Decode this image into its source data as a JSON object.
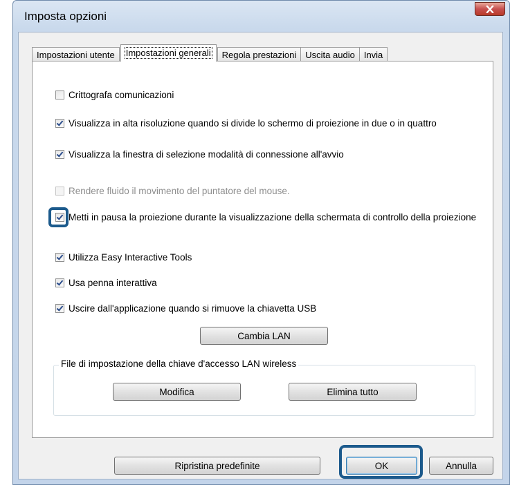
{
  "window": {
    "title": "Imposta opzioni"
  },
  "tabs": [
    {
      "label": "Impostazioni utente",
      "active": false
    },
    {
      "label": "Impostazioni generali",
      "active": true
    },
    {
      "label": "Regola prestazioni",
      "active": false
    },
    {
      "label": "Uscita audio",
      "active": false
    },
    {
      "label": "Invia",
      "active": false
    }
  ],
  "options": [
    {
      "label": "Crittografa comunicazioni",
      "checked": false,
      "enabled": true
    },
    {
      "label": "Visualizza in alta risoluzione quando si divide lo schermo di proiezione in due o in quattro",
      "checked": true,
      "enabled": true
    },
    {
      "label": "Visualizza la finestra di selezione modalità di connessione all'avvio",
      "checked": true,
      "enabled": true
    },
    {
      "label": "Rendere fluido il movimento del puntatore del mouse.",
      "checked": false,
      "enabled": false
    },
    {
      "label": "Metti in pausa la proiezione  durante la visualizzazione della schermata di controllo della proiezione",
      "checked": true,
      "enabled": true
    },
    {
      "label": "Utilizza Easy Interactive Tools",
      "checked": true,
      "enabled": true
    },
    {
      "label": "Usa penna interattiva",
      "checked": true,
      "enabled": true
    },
    {
      "label": "Uscire dall'applicazione quando si rimuove la chiavetta USB",
      "checked": true,
      "enabled": true
    }
  ],
  "buttons": {
    "change_lan": "Cambia LAN",
    "edit": "Modifica",
    "delete_all": "Elimina tutto",
    "restore_defaults": "Ripristina predefinite",
    "ok": "OK",
    "cancel": "Annulla"
  },
  "group": {
    "title": "File di impostazione della chiave d'accesso LAN wireless"
  },
  "icons": {
    "close": "close-icon"
  },
  "colors": {
    "highlight": "#1c5a8c",
    "close_button": "#c75050",
    "check": "#2b4d8c"
  }
}
